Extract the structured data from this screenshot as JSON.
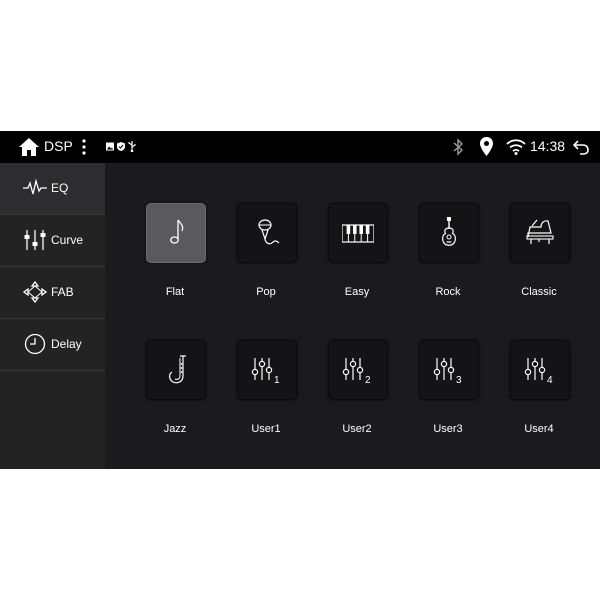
{
  "statusbar": {
    "app_title": "DSP",
    "time": "14:38",
    "icons": [
      "home-icon",
      "more-vert-icon",
      "image-notification-icon",
      "shield-notification-icon",
      "usb-notification-icon",
      "bluetooth-icon",
      "location-icon",
      "wifi-icon",
      "back-icon"
    ]
  },
  "sidebar": {
    "items": [
      {
        "label": "EQ",
        "icon": "waveform-icon",
        "active": true
      },
      {
        "label": "Curve",
        "icon": "equalizer-sliders-icon",
        "active": false
      },
      {
        "label": "FAB",
        "icon": "fader-balance-icon",
        "active": false
      },
      {
        "label": "Delay",
        "icon": "clock-icon",
        "active": false
      }
    ]
  },
  "presets": [
    {
      "label": "Flat",
      "icon": "music-note-icon",
      "selected": true
    },
    {
      "label": "Pop",
      "icon": "microphone-icon",
      "selected": false
    },
    {
      "label": "Easy",
      "icon": "piano-keys-icon",
      "selected": false
    },
    {
      "label": "Rock",
      "icon": "guitar-icon",
      "selected": false
    },
    {
      "label": "Classic",
      "icon": "grand-piano-icon",
      "selected": false
    },
    {
      "label": "Jazz",
      "icon": "saxophone-icon",
      "selected": false
    },
    {
      "label": "User1",
      "icon": "user-eq-icon",
      "digit": "1",
      "selected": false
    },
    {
      "label": "User2",
      "icon": "user-eq-icon",
      "digit": "2",
      "selected": false
    },
    {
      "label": "User3",
      "icon": "user-eq-icon",
      "digit": "3",
      "selected": false
    },
    {
      "label": "User4",
      "icon": "user-eq-icon",
      "digit": "4",
      "selected": false
    }
  ],
  "colors": {
    "background": "#1b1b1d",
    "statusbar": "#000000",
    "sidebar": "#232324",
    "tile": "#141416",
    "tile_selected": "#5a5a5c",
    "text": "#ffffff"
  }
}
